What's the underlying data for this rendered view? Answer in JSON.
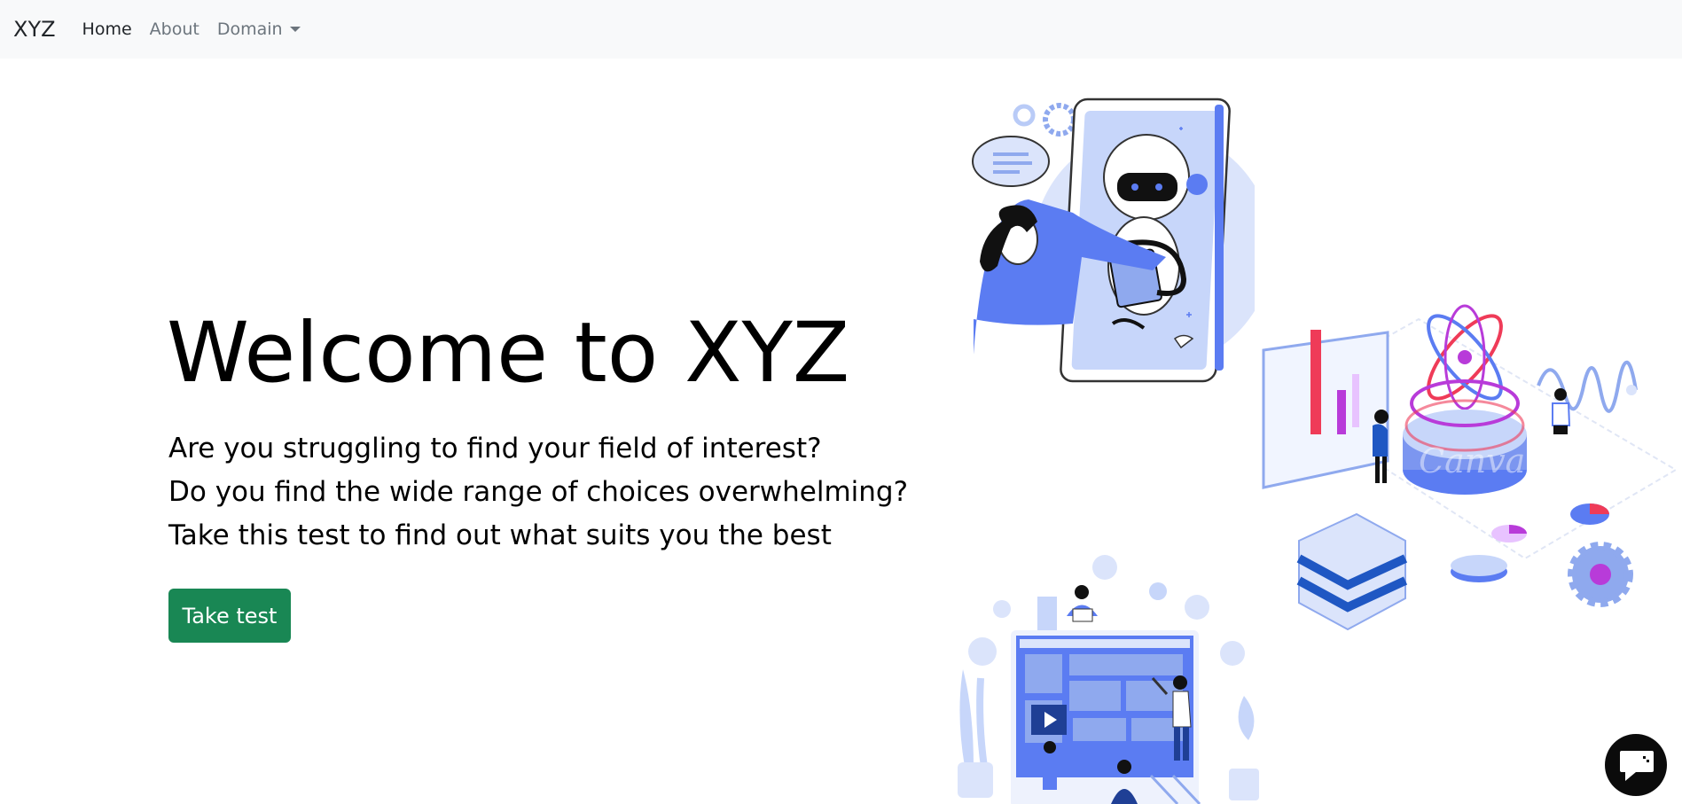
{
  "nav": {
    "brand": "XYZ",
    "links": [
      {
        "label": "Home",
        "active": true
      },
      {
        "label": "About",
        "active": false
      },
      {
        "label": "Domain",
        "active": false,
        "dropdown": true
      }
    ]
  },
  "hero": {
    "title": "Welcome to XYZ",
    "lines": [
      "Are you struggling to find your field of interest?",
      "Do you find the wide range of choices overwhelming?",
      "Take this test to find out what suits you the best"
    ],
    "cta_label": "Take test",
    "cta_color": "#198754"
  },
  "illustrations": {
    "top": "chatbot-assistant-illustration",
    "right": "data-science-isometric-illustration",
    "bottom": "web-development-team-illustration",
    "watermark": "Canva"
  },
  "chat_widget": {
    "icon": "chat-bubble-icon"
  },
  "colors": {
    "accent_blue": "#5b7cf2",
    "light_blue": "#b9cbf7",
    "navbar_bg": "#f8f9fa"
  }
}
